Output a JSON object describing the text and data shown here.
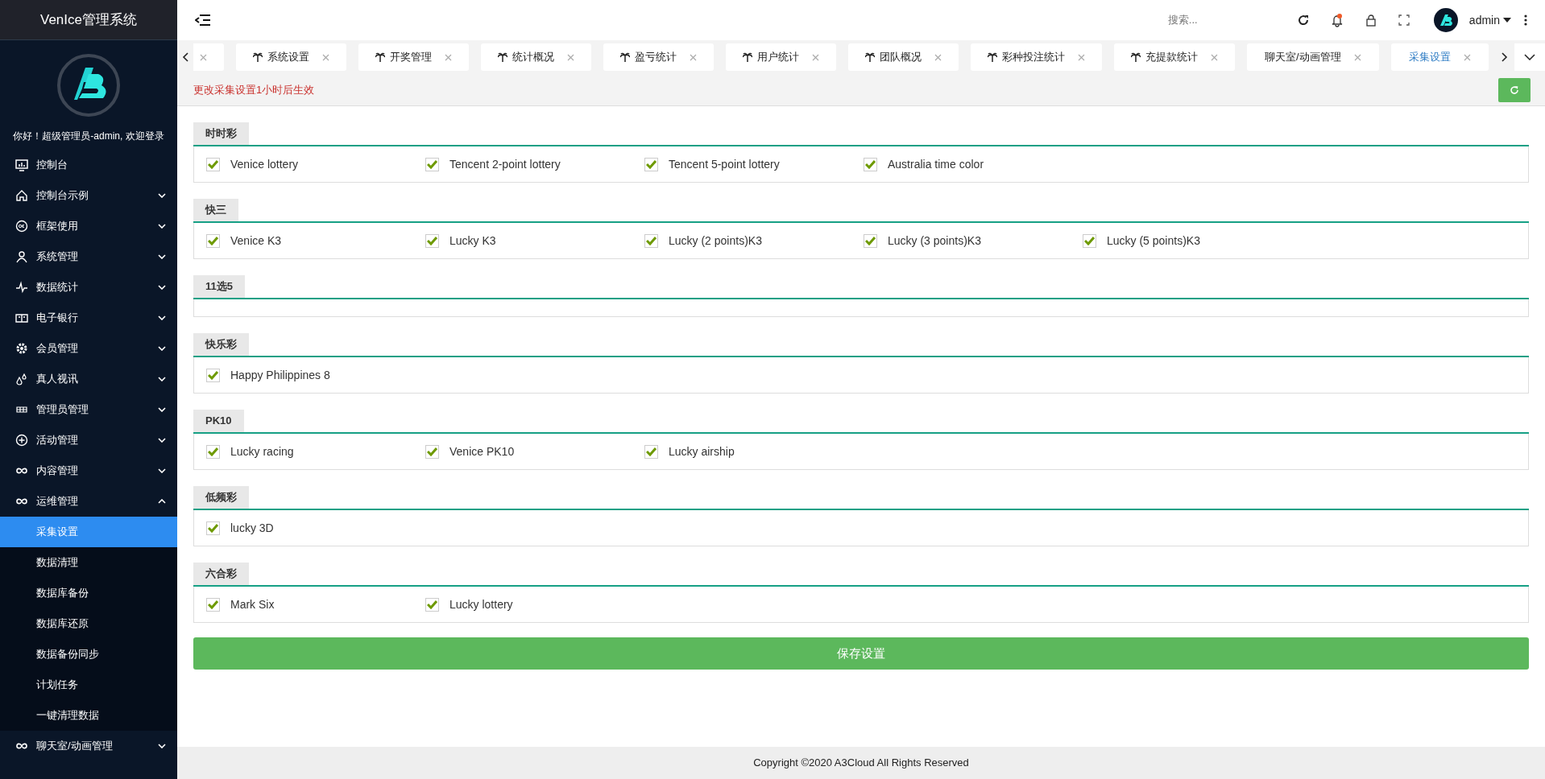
{
  "sidebar": {
    "title": "VenIce管理系统",
    "greeting": "你好！超级管理员-admin, 欢迎登录",
    "items": [
      {
        "label": "控制台"
      },
      {
        "label": "控制台示例",
        "expanded": false
      },
      {
        "label": "框架使用",
        "expanded": false
      },
      {
        "label": "系统管理",
        "expanded": false
      },
      {
        "label": "数据统计",
        "expanded": false
      },
      {
        "label": "电子银行",
        "expanded": false
      },
      {
        "label": "会员管理",
        "expanded": false
      },
      {
        "label": "真人视讯",
        "expanded": false
      },
      {
        "label": "管理员管理",
        "expanded": false
      },
      {
        "label": "活动管理",
        "expanded": false
      },
      {
        "label": "内容管理",
        "expanded": false
      },
      {
        "label": "运维管理",
        "expanded": true,
        "children": [
          {
            "label": "采集设置",
            "selected": true
          },
          {
            "label": "数据清理",
            "selected": false
          },
          {
            "label": "数据库备份",
            "selected": false
          },
          {
            "label": "数据库还原",
            "selected": false
          },
          {
            "label": "数据备份同步",
            "selected": false
          },
          {
            "label": "计划任务",
            "selected": false
          },
          {
            "label": "一键清理数据",
            "selected": false
          }
        ]
      },
      {
        "label": "聊天室/动画管理",
        "expanded": false
      }
    ]
  },
  "header": {
    "search": {
      "placeholder": "搜索..."
    },
    "user": "admin"
  },
  "tabs": [
    {
      "kind": "stub"
    },
    {
      "kind": "icon",
      "label": "系统设置",
      "selected": false
    },
    {
      "kind": "icon",
      "label": "开奖管理",
      "selected": false
    },
    {
      "kind": "icon",
      "label": "统计概况",
      "selected": false
    },
    {
      "kind": "icon",
      "label": "盈亏统计",
      "selected": false
    },
    {
      "kind": "icon",
      "label": "用户统计",
      "selected": false
    },
    {
      "kind": "icon",
      "label": "团队概况",
      "selected": false
    },
    {
      "kind": "icon",
      "label": "彩种投注统计",
      "selected": false
    },
    {
      "kind": "icon",
      "label": "充提款统计",
      "selected": false
    },
    {
      "kind": "plain",
      "label": "聊天室/动画管理",
      "selected": false
    },
    {
      "kind": "plain",
      "label": "采集设置",
      "selected": true
    }
  ],
  "notice": "更改采集设置1小时后生效",
  "groups": [
    {
      "title": "时时彩",
      "options": [
        {
          "label": "Venice lottery",
          "checked": true
        },
        {
          "label": "Tencent 2-point lottery",
          "checked": true
        },
        {
          "label": "Tencent 5-point lottery",
          "checked": true
        },
        {
          "label": "Australia time color",
          "checked": true
        }
      ]
    },
    {
      "title": "快三",
      "options": [
        {
          "label": "Venice K3",
          "checked": true
        },
        {
          "label": "Lucky K3",
          "checked": true
        },
        {
          "label": "Lucky (2 points)K3",
          "checked": true
        },
        {
          "label": "Lucky (3 points)K3",
          "checked": true
        },
        {
          "label": "Lucky (5 points)K3",
          "checked": true
        }
      ]
    },
    {
      "title": "11选5"
    },
    {
      "title": "快乐彩",
      "options": [
        {
          "label": "Happy Philippines 8",
          "checked": true
        }
      ]
    },
    {
      "title": "PK10",
      "options": [
        {
          "label": "Lucky racing",
          "checked": true
        },
        {
          "label": "Venice PK10",
          "checked": true
        },
        {
          "label": "Lucky airship",
          "checked": true
        }
      ]
    },
    {
      "title": "低频彩",
      "options": [
        {
          "label": "lucky 3D",
          "checked": true
        }
      ]
    },
    {
      "title": "六合彩",
      "options": [
        {
          "label": "Mark Six",
          "checked": true
        },
        {
          "label": "Lucky lottery",
          "checked": true
        }
      ]
    }
  ],
  "save_button": "保存设置",
  "footer": "Copyright ©2020 A3Cloud All Rights Reserved"
}
